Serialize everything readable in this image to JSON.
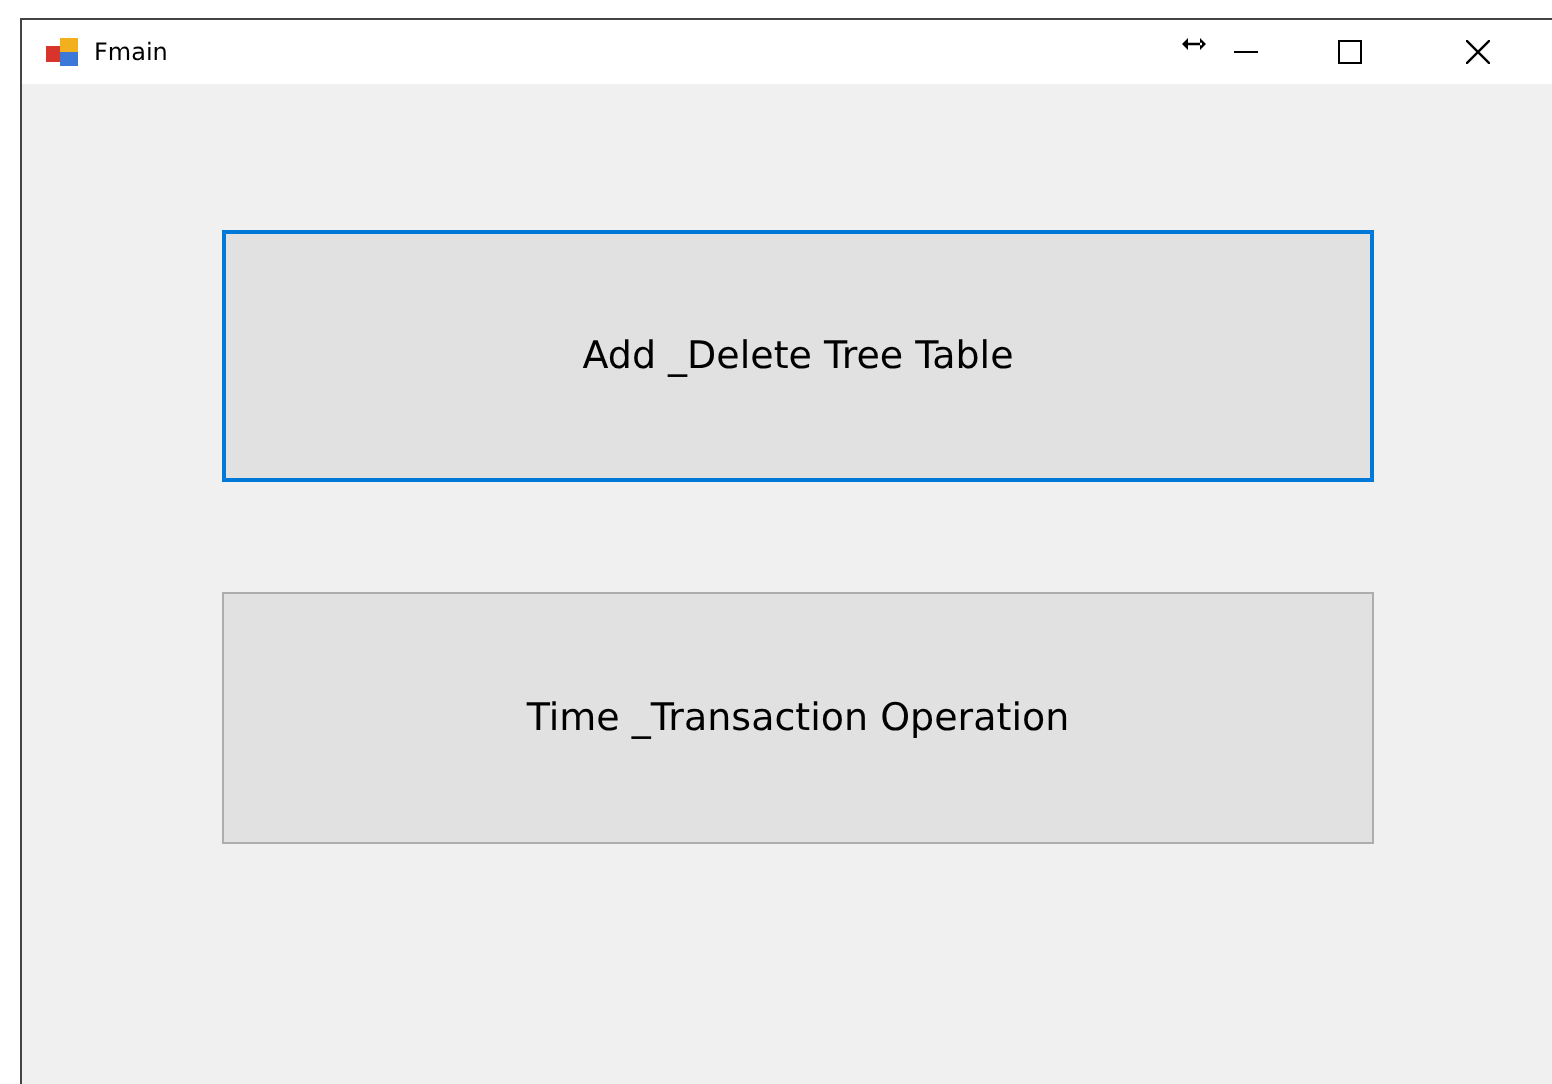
{
  "window": {
    "title": "Fmain"
  },
  "buttons": [
    {
      "label": "Add _Delete Tree Table",
      "focused": true
    },
    {
      "label": "Time _Transaction Operation",
      "focused": false
    }
  ]
}
